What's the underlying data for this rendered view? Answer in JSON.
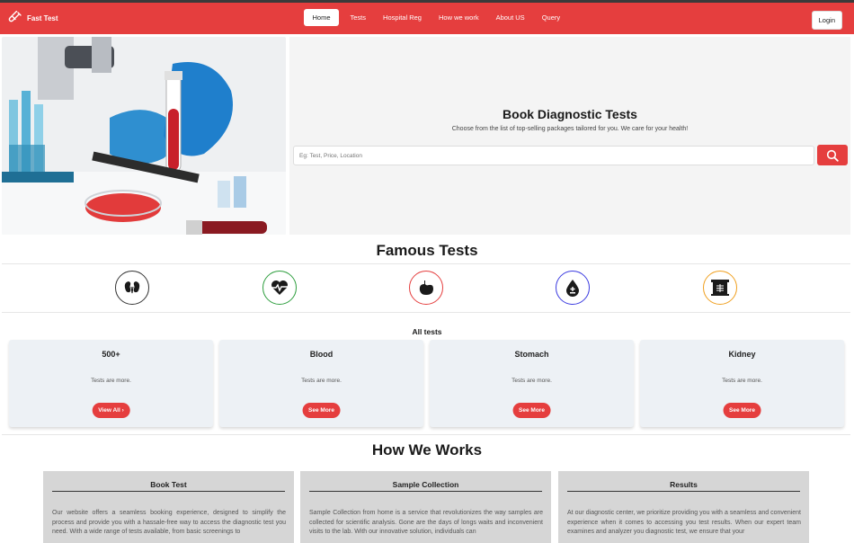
{
  "brand": {
    "name": "Fast Test",
    "icon": "test-tube-icon"
  },
  "nav": {
    "items": [
      {
        "label": "Home",
        "active": true
      },
      {
        "label": "Tests",
        "active": false
      },
      {
        "label": "Hospital Reg",
        "active": false
      },
      {
        "label": "How we work",
        "active": false
      },
      {
        "label": "About US",
        "active": false
      },
      {
        "label": "Query",
        "active": false
      }
    ],
    "login_label": "Login"
  },
  "hero": {
    "title": "Book Diagnostic Tests",
    "subtitle": "Choose from the list of top-selling packages tailored for you. We care for your health!",
    "search_placeholder": "Eg: Test, Price, Location",
    "search_icon": "search-icon"
  },
  "famous_tests": {
    "title": "Famous Tests",
    "icons": [
      {
        "name": "kidney-icon",
        "color": "#333333"
      },
      {
        "name": "heart-pulse-icon",
        "color": "#2e9e3e"
      },
      {
        "name": "stomach-icon",
        "color": "#e53e3e"
      },
      {
        "name": "blood-drop-icon",
        "color": "#3b3be0"
      },
      {
        "name": "xray-icon",
        "color": "#f0a020"
      }
    ]
  },
  "all_tests": {
    "title": "All tests",
    "cards": [
      {
        "title": "500+",
        "desc": "Tests are more.",
        "button": "View All"
      },
      {
        "title": "Blood",
        "desc": "Tests are more.",
        "button": "See More"
      },
      {
        "title": "Stomach",
        "desc": "Tests are more.",
        "button": "See More"
      },
      {
        "title": "Kidney",
        "desc": "Tests are more.",
        "button": "See More"
      }
    ]
  },
  "how_we_work": {
    "title": "How We Works",
    "cards": [
      {
        "title": "Book Test",
        "text": "Our website offers a seamless booking experience, designed to simplify the process and provide you with a hassale-free way to access the diagnostic test you need. With a wide range of tests available, from basic screenings to"
      },
      {
        "title": "Sample Collection",
        "text": "Sample Collection from home is a service that revolutionizes the way samples are collected for scientific analysis. Gone are the days of longs waits and inconvenient visits to the lab. With our innovative solution, individuals can"
      },
      {
        "title": "Results",
        "text": "At our diagnostic center, we prioritize providing you with a seamless and convenient experience when it comes to accessing you test results. When our expert team examines and analyzer you diagnostic test, we ensure that your"
      }
    ]
  },
  "colors": {
    "accent": "#e53e3e",
    "panel": "#f4f4f4",
    "card": "#edf1f5"
  }
}
